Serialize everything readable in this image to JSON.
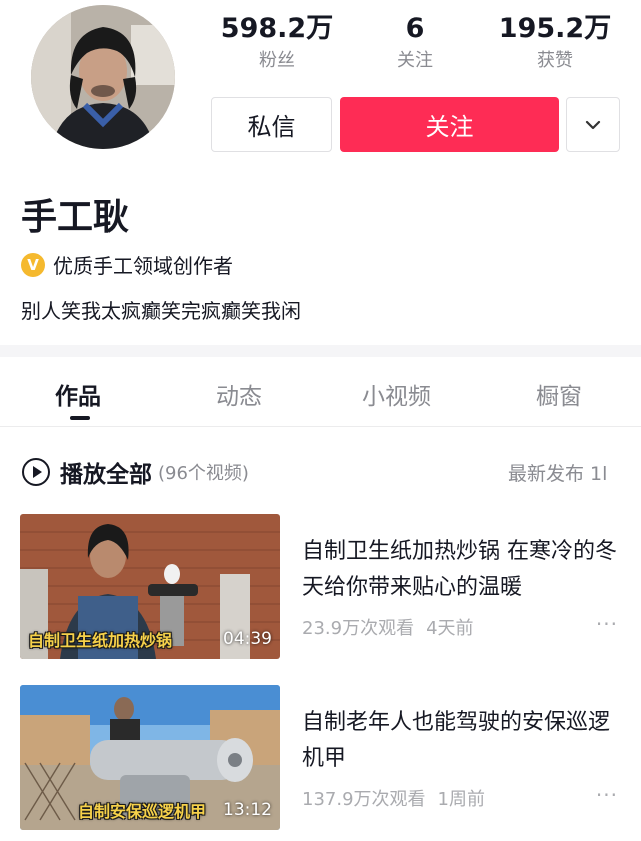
{
  "profile": {
    "name": "手工耿",
    "badge_text": "优质手工领域创作者",
    "badge_icon": "verified-v-icon",
    "bio": "别人笑我太疯癫笑完疯癫笑我闲"
  },
  "stats": [
    {
      "value": "598.2万",
      "label": "粉丝"
    },
    {
      "value": "6",
      "label": "关注"
    },
    {
      "value": "195.2万",
      "label": "获赞"
    }
  ],
  "actions": {
    "message_label": "私信",
    "follow_label": "关注",
    "more_icon": "chevron-down-icon"
  },
  "tabs": [
    {
      "label": "作品",
      "active": true
    },
    {
      "label": "动态",
      "active": false
    },
    {
      "label": "小视频",
      "active": false
    },
    {
      "label": "橱窗",
      "active": false
    }
  ],
  "playall": {
    "label": "播放全部",
    "count": "(96个视频)",
    "sort": "最新发布 1l"
  },
  "videos": [
    {
      "thumb_caption": "自制卫生纸加热炒锅",
      "duration": "04:39",
      "title": "自制卫生纸加热炒锅 在寒冷的冬天给你带来贴心的温暖",
      "views": "23.9万次观看",
      "time": "4天前"
    },
    {
      "thumb_caption": "自制安保巡逻机甲",
      "duration": "13:12",
      "title": "自制老年人也能驾驶的安保巡逻机甲",
      "views": "137.9万次观看",
      "time": "1周前"
    }
  ],
  "colors": {
    "accent": "#fe2c55",
    "badge": "#f5b92e",
    "caption": "#f6d14a"
  }
}
